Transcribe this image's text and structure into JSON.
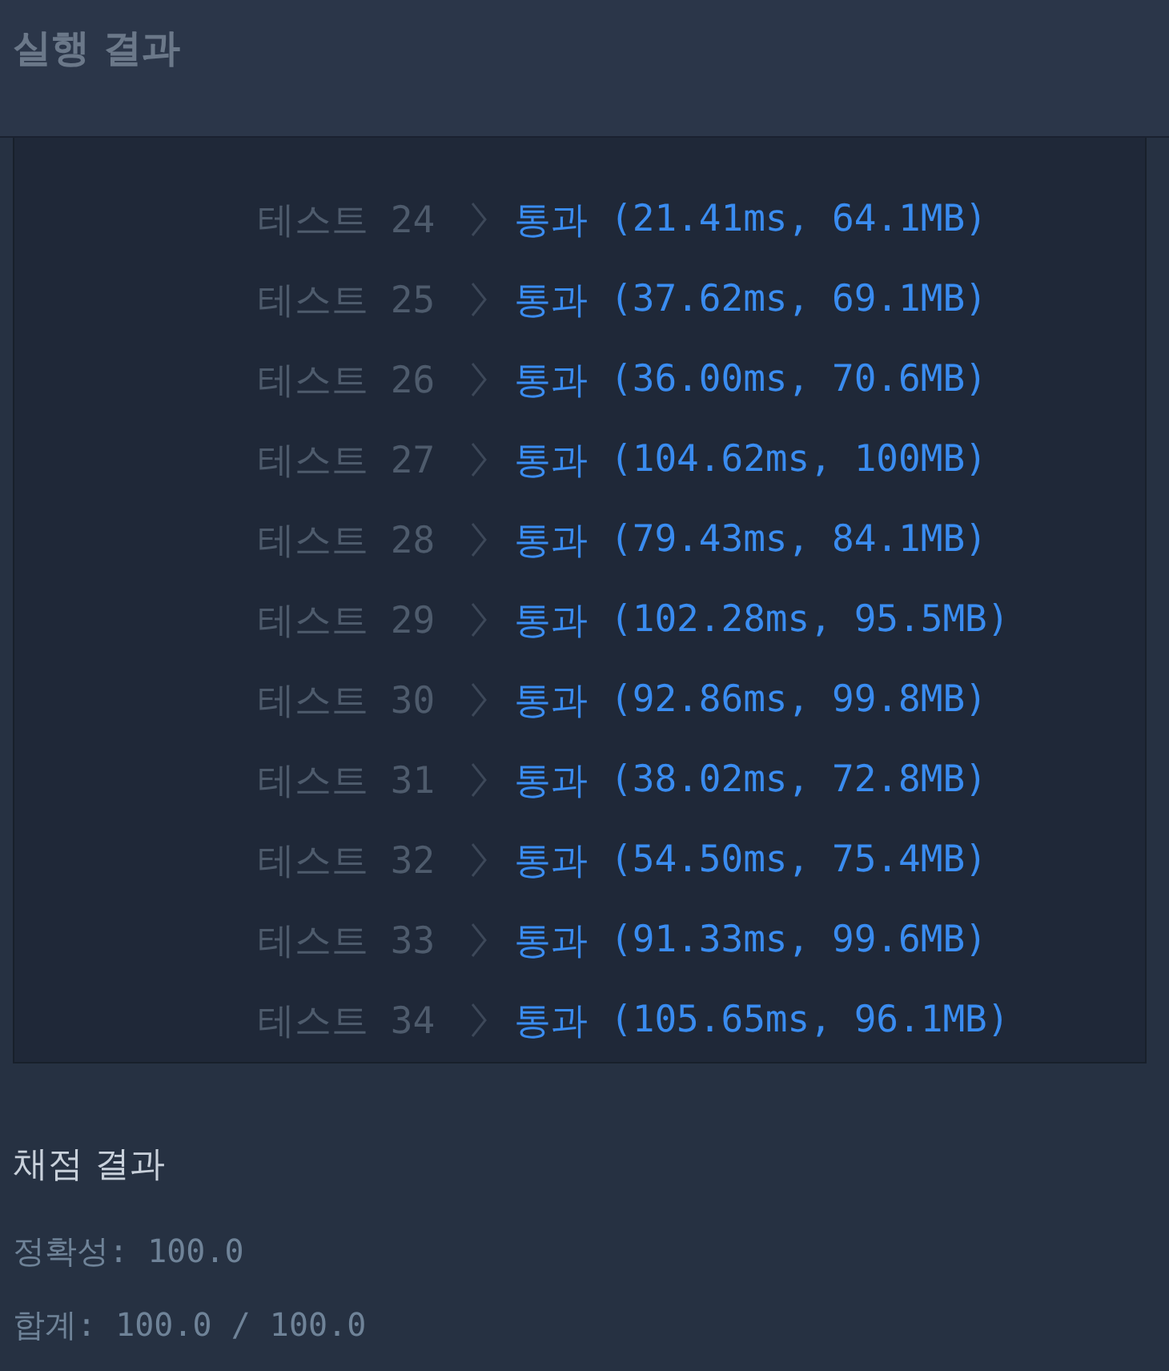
{
  "header": {
    "title": "실행 결과"
  },
  "results": [
    {
      "label": "테스트 24",
      "kind": "pass",
      "status_text": "통과",
      "detail": "(21.41ms, 64.1MB)"
    },
    {
      "label": "테스트 25",
      "kind": "pass",
      "status_text": "통과",
      "detail": "(37.62ms, 69.1MB)"
    },
    {
      "label": "테스트 26",
      "kind": "pass",
      "status_text": "통과",
      "detail": "(36.00ms, 70.6MB)"
    },
    {
      "label": "테스트 27",
      "kind": "pass",
      "status_text": "통과",
      "detail": "(104.62ms, 100MB)"
    },
    {
      "label": "테스트 28",
      "kind": "pass",
      "status_text": "통과",
      "detail": "(79.43ms, 84.1MB)"
    },
    {
      "label": "테스트 29",
      "kind": "pass",
      "status_text": "통과",
      "detail": "(102.28ms, 95.5MB)"
    },
    {
      "label": "테스트 30",
      "kind": "pass",
      "status_text": "통과",
      "detail": "(92.86ms, 99.8MB)"
    },
    {
      "label": "테스트 31",
      "kind": "pass",
      "status_text": "통과",
      "detail": "(38.02ms, 72.8MB)"
    },
    {
      "label": "테스트 32",
      "kind": "pass",
      "status_text": "통과",
      "detail": "(54.50ms, 75.4MB)"
    },
    {
      "label": "테스트 33",
      "kind": "pass",
      "status_text": "통과",
      "detail": "(91.33ms, 99.6MB)"
    },
    {
      "label": "테스트 34",
      "kind": "pass",
      "status_text": "통과",
      "detail": "(105.65ms, 96.1MB)"
    }
  ],
  "grading": {
    "title": "채점 결과",
    "lines": [
      "정확성: 100.0",
      "합계: 100.0 / 100.0"
    ]
  }
}
